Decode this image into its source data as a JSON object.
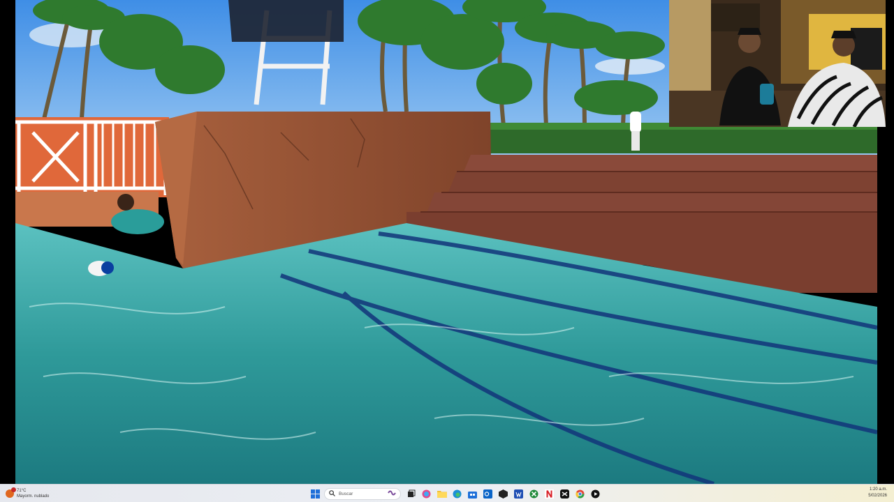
{
  "taskbar": {
    "weather": {
      "temperature": "71°C",
      "condition": "Mayorm. nublado",
      "icon": "weather-sun-icon",
      "notification_badge": "1"
    },
    "search_label": "Buscar",
    "pinned_apps": [
      "windows-start-icon",
      "search-icon",
      "copilot-icon",
      "task-view-icon",
      "colorful-app-icon",
      "file-explorer-icon",
      "edge-icon",
      "store-icon",
      "outlook-icon",
      "dark-app-icon",
      "word-app-icon",
      "xbox-icon",
      "netflix-icon",
      "capcut-icon",
      "chrome-icon",
      "media-player-icon"
    ],
    "clock": {
      "time": "1:20 a.m.",
      "date": "5/02/2026"
    }
  },
  "colors": {
    "taskbar_bg": "#eceff4",
    "pool_water": "#2f9a9a",
    "accent_blue": "#0a64c8"
  }
}
